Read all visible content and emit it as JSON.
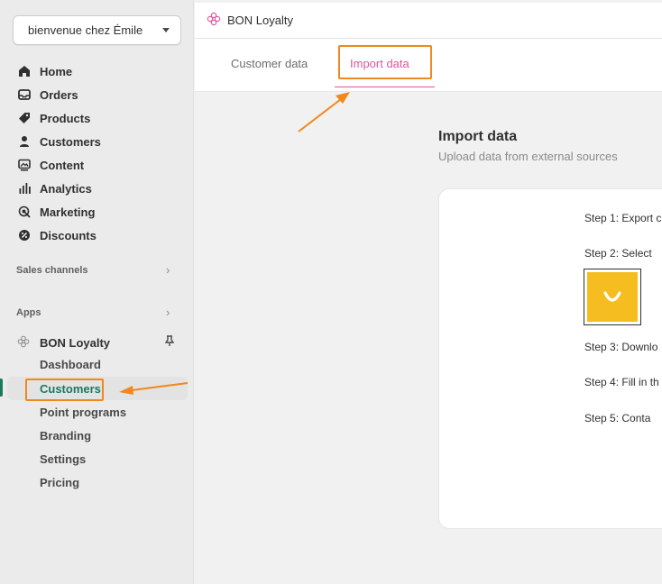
{
  "sidebar": {
    "store_name": "bienvenue chez Émile",
    "nav": [
      {
        "label": "Home",
        "icon": "home-icon"
      },
      {
        "label": "Orders",
        "icon": "inbox-icon"
      },
      {
        "label": "Products",
        "icon": "tag-icon"
      },
      {
        "label": "Customers",
        "icon": "person-icon"
      },
      {
        "label": "Content",
        "icon": "image-icon"
      },
      {
        "label": "Analytics",
        "icon": "bar-chart-icon"
      },
      {
        "label": "Marketing",
        "icon": "target-icon"
      },
      {
        "label": "Discounts",
        "icon": "percent-icon"
      }
    ],
    "sales_channels_label": "Sales channels",
    "apps_label": "Apps",
    "app_name": "BON Loyalty",
    "app_sub_items": [
      {
        "label": "Dashboard"
      },
      {
        "label": "Customers"
      },
      {
        "label": "Point programs"
      },
      {
        "label": "Branding"
      },
      {
        "label": "Settings"
      },
      {
        "label": "Pricing"
      }
    ]
  },
  "topbar": {
    "title": "BON Loyalty"
  },
  "tabs": [
    {
      "label": "Customer data"
    },
    {
      "label": "Import data"
    }
  ],
  "main": {
    "title": "Import data",
    "subtitle": "Upload data from external sources",
    "steps": [
      "Step 1: Export c",
      "Step 2: Select",
      "Step 3: Downlo",
      "Step 4: Fill in th",
      "Step 5: Conta"
    ]
  },
  "colors": {
    "accent_pink": "#e0569c",
    "active_green": "#1a7a5e",
    "highlight_orange": "#f0881d",
    "logo_yellow": "#f5bd1f"
  }
}
